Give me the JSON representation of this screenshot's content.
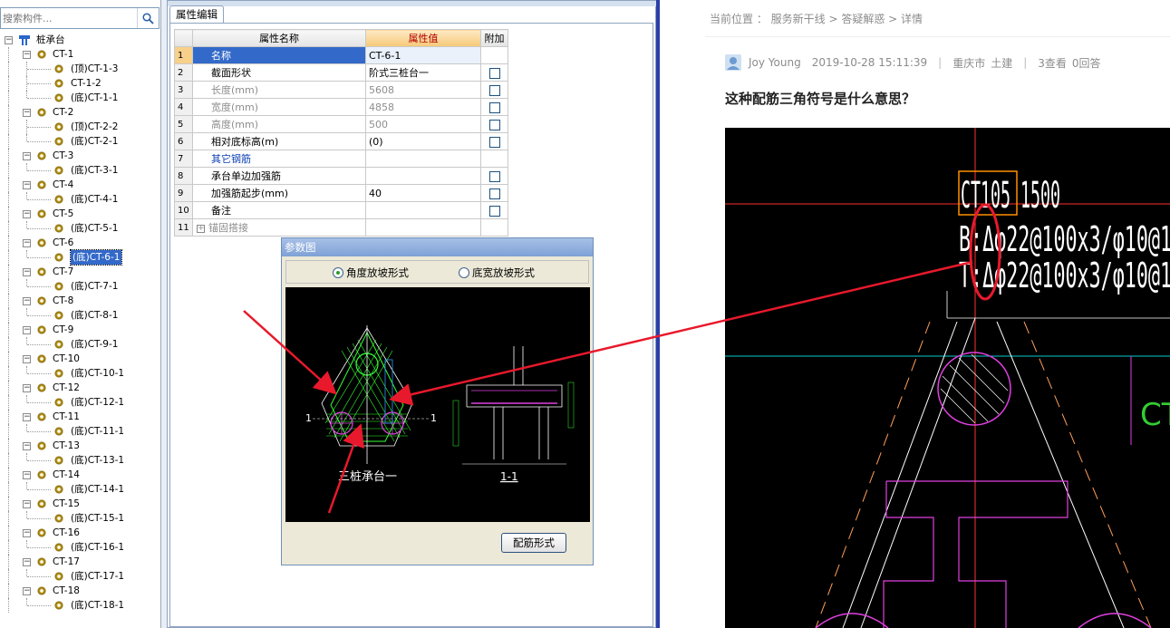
{
  "search": {
    "placeholder": "搜索构件..."
  },
  "tree": {
    "root": "桩承台",
    "items": [
      {
        "label": "CT-1",
        "level": 1
      },
      {
        "label": "(顶)CT-1-3",
        "level": 2
      },
      {
        "label": "CT-1-2",
        "level": 2
      },
      {
        "label": "(底)CT-1-1",
        "level": 2
      },
      {
        "label": "CT-2",
        "level": 1
      },
      {
        "label": "(顶)CT-2-2",
        "level": 2
      },
      {
        "label": "(底)CT-2-1",
        "level": 2
      },
      {
        "label": "CT-3",
        "level": 1
      },
      {
        "label": "(底)CT-3-1",
        "level": 2
      },
      {
        "label": "CT-4",
        "level": 1
      },
      {
        "label": "(底)CT-4-1",
        "level": 2
      },
      {
        "label": "CT-5",
        "level": 1
      },
      {
        "label": "(底)CT-5-1",
        "level": 2
      },
      {
        "label": "CT-6",
        "level": 1
      },
      {
        "label": "(底)CT-6-1",
        "level": 2,
        "selected": true
      },
      {
        "label": "CT-7",
        "level": 1
      },
      {
        "label": "(底)CT-7-1",
        "level": 2
      },
      {
        "label": "CT-8",
        "level": 1
      },
      {
        "label": "(底)CT-8-1",
        "level": 2
      },
      {
        "label": "CT-9",
        "level": 1
      },
      {
        "label": "(底)CT-9-1",
        "level": 2
      },
      {
        "label": "CT-10",
        "level": 1
      },
      {
        "label": "(底)CT-10-1",
        "level": 2
      },
      {
        "label": "CT-12",
        "level": 1
      },
      {
        "label": "(底)CT-12-1",
        "level": 2
      },
      {
        "label": "CT-11",
        "level": 1
      },
      {
        "label": "(底)CT-11-1",
        "level": 2
      },
      {
        "label": "CT-13",
        "level": 1
      },
      {
        "label": "(底)CT-13-1",
        "level": 2
      },
      {
        "label": "CT-14",
        "level": 1
      },
      {
        "label": "(底)CT-14-1",
        "level": 2
      },
      {
        "label": "CT-15",
        "level": 1
      },
      {
        "label": "(底)CT-15-1",
        "level": 2
      },
      {
        "label": "CT-16",
        "level": 1
      },
      {
        "label": "(底)CT-16-1",
        "level": 2
      },
      {
        "label": "CT-17",
        "level": 1
      },
      {
        "label": "(底)CT-17-1",
        "level": 2
      },
      {
        "label": "CT-18",
        "level": 1
      },
      {
        "label": "(底)CT-18-1",
        "level": 2
      }
    ]
  },
  "props": {
    "tab": "属性编辑",
    "headers": {
      "name": "属性名称",
      "value": "属性值",
      "extra": "附加"
    },
    "rows": [
      {
        "num": "1",
        "name": "名称",
        "value": "CT-6-1",
        "check": false,
        "selected": true
      },
      {
        "num": "2",
        "name": "截面形状",
        "value": "阶式三桩台一",
        "check": true
      },
      {
        "num": "3",
        "name": "长度(mm)",
        "value": "5608",
        "check": true,
        "dim": true
      },
      {
        "num": "4",
        "name": "宽度(mm)",
        "value": "4858",
        "check": true,
        "dim": true
      },
      {
        "num": "5",
        "name": "高度(mm)",
        "value": "500",
        "check": true,
        "dim": true
      },
      {
        "num": "6",
        "name": "相对底标高(m)",
        "value": "(0)",
        "check": true
      },
      {
        "num": "7",
        "name": "其它钢筋",
        "value": "",
        "check": false,
        "blue": true
      },
      {
        "num": "8",
        "name": "承台单边加强筋",
        "value": "",
        "check": true
      },
      {
        "num": "9",
        "name": "加强筋起步(mm)",
        "value": "40",
        "check": true
      },
      {
        "num": "10",
        "name": "备注",
        "value": "",
        "check": true
      },
      {
        "num": "11",
        "name": "锚固搭接",
        "value": "",
        "check": false,
        "dim": true,
        "expand": true
      }
    ]
  },
  "dialog": {
    "title": "参数图",
    "radio1": "角度放坡形式",
    "radio2": "底宽放坡形式",
    "radio_selected": 1,
    "drawing_title": "三桩承台一",
    "section_label": "1-1",
    "mark_left": "1",
    "mark_right": "1",
    "button": "配筋形式"
  },
  "right": {
    "breadcrumb": "当前位置 ： 服务新干线 > 答疑解惑 > 详情",
    "author": "Joy Young",
    "datetime": "2019-10-28 15:11:39",
    "location": "重庆市",
    "category": "土建",
    "views": "3查看",
    "answers": "0回答",
    "question": "这种配筋三角符号是什么意思？",
    "cad": {
      "line1": "CT105 1500",
      "line2": "B:Δφ22@100x3/φ10@1",
      "line3": "T:Δφ22@100x3/φ10@1",
      "side": "CT"
    }
  },
  "colors": {
    "accent": "#3369c9",
    "annotation": "#e8192c",
    "cad_green": "#33ff33",
    "cad_magenta": "#e040e0",
    "divider": "#2a3ea8"
  }
}
